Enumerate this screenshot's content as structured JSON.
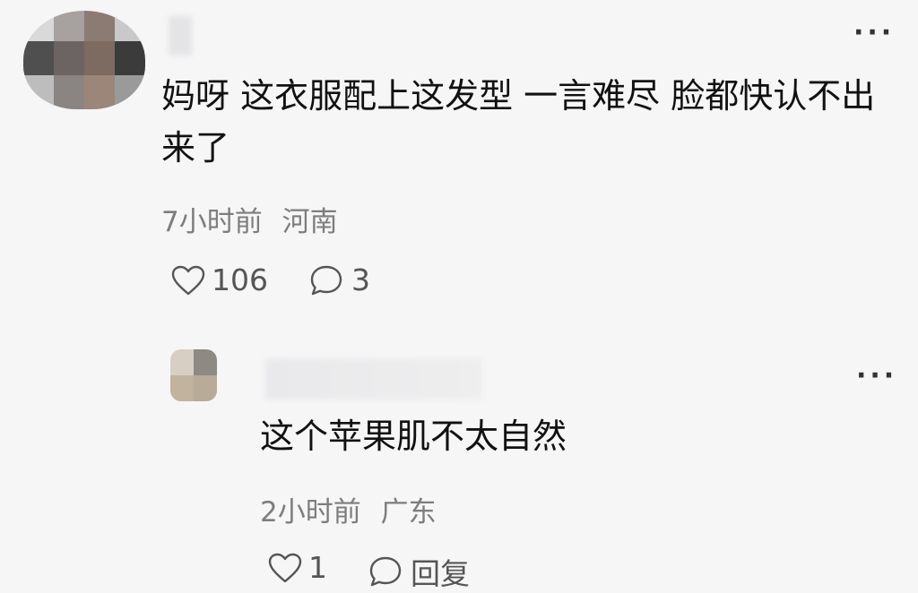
{
  "comment": {
    "text": "妈呀 这衣服配上这发型 一言难尽 脸都快认不出来了",
    "time": "7小时前",
    "location": "河南",
    "likes": "106",
    "replies": "3",
    "more_icon": "more-dots-icon"
  },
  "reply": {
    "text": "这个苹果肌不太自然",
    "time": "2小时前",
    "location": "广东",
    "likes": "1",
    "reply_label": "回复",
    "more_icon": "more-dots-icon"
  },
  "icons": {
    "like": "heart-outline-icon",
    "comment": "speech-bubble-icon"
  },
  "colors": {
    "background": "#f6f6f7",
    "text": "#111111",
    "meta": "#7d7d7d",
    "icon": "#555555"
  }
}
